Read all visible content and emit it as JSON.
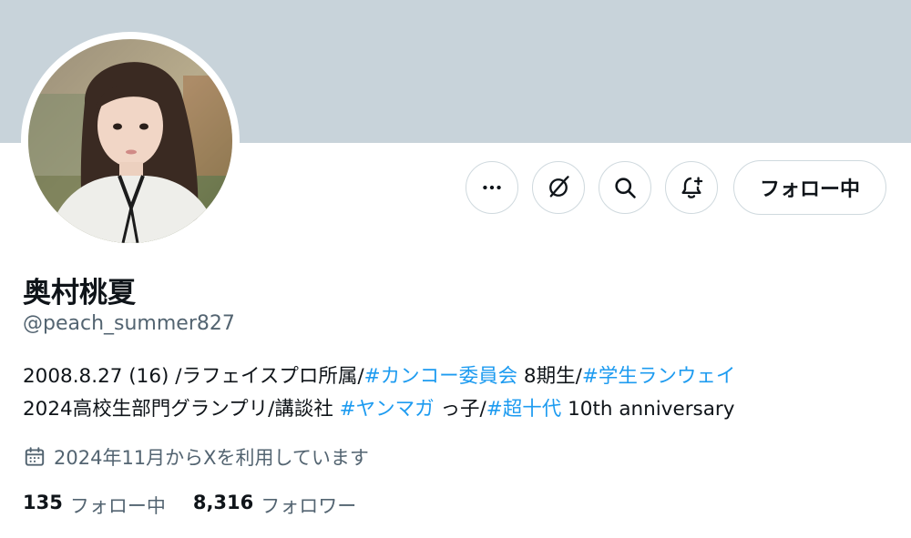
{
  "profile": {
    "display_name": "奥村桃夏",
    "handle": "@peach_summer827",
    "bio": {
      "line1": [
        {
          "text": "2008.8.27 (16) /ラフェイスプロ所属/",
          "tag": false
        },
        {
          "text": "#カンコー委員会",
          "tag": true
        },
        {
          "text": " 8期生/",
          "tag": false
        },
        {
          "text": "#学生ランウェイ",
          "tag": true
        }
      ],
      "line2": [
        {
          "text": "2024高校生部門グランプリ/講談社 ",
          "tag": false
        },
        {
          "text": "#ヤンマガ",
          "tag": true
        },
        {
          "text": " っ子/",
          "tag": false
        },
        {
          "text": "#超十代",
          "tag": true
        },
        {
          "text": " 10th anniversary",
          "tag": false
        }
      ]
    },
    "joined": "2024年11月からXを利用しています",
    "following_count": "135",
    "following_label": "フォロー中",
    "followers_count": "8,316",
    "followers_label": "フォロワー"
  },
  "actions": {
    "more_icon": "more-icon",
    "grok_icon": "grok-icon",
    "search_icon": "search-icon",
    "notify_icon": "bell-plus-icon",
    "follow_label": "フォロー中"
  },
  "colors": {
    "banner": "#c8d3da",
    "link": "#1d9bf0",
    "secondary_text": "#536471",
    "border": "#cfd9de"
  }
}
